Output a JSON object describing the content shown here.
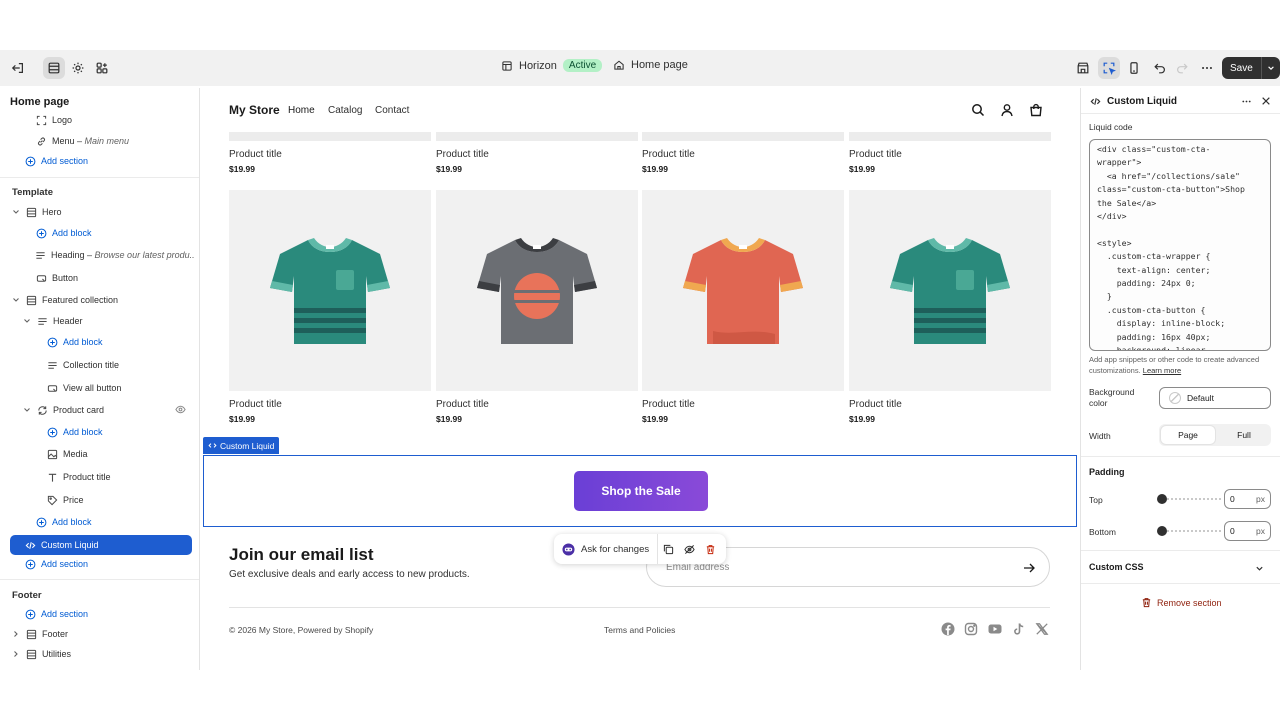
{
  "topbar": {
    "theme_name": "Horizon",
    "theme_status": "Active",
    "page_name": "Home page",
    "save_label": "Save"
  },
  "sidebar": {
    "title": "Home page",
    "header_items": {
      "logo": "Logo",
      "menu": "Menu",
      "menu_sub": "Main menu",
      "add_section": "Add section"
    },
    "template_label": "Template",
    "template": {
      "hero": "Hero",
      "add_block": "Add block",
      "heading": "Heading",
      "heading_sub": "Browse our latest produ...",
      "button": "Button",
      "featured_collection": "Featured collection",
      "header": "Header",
      "collection_title": "Collection title",
      "view_all_button": "View all button",
      "product_card": "Product card",
      "media": "Media",
      "product_title": "Product title",
      "price": "Price",
      "custom_liquid": "Custom Liquid",
      "add_section": "Add section"
    },
    "footer_label": "Footer",
    "footer": {
      "add_section": "Add section",
      "footer": "Footer",
      "utilities": "Utilities"
    }
  },
  "store": {
    "logo": "My Store",
    "nav": [
      "Home",
      "Catalog",
      "Contact"
    ],
    "products_row1": [
      {
        "title": "Product title",
        "price": "$19.99"
      },
      {
        "title": "Product title",
        "price": "$19.99"
      },
      {
        "title": "Product title",
        "price": "$19.99"
      },
      {
        "title": "Product title",
        "price": "$19.99"
      }
    ],
    "products_row2": [
      {
        "title": "Product title",
        "price": "$19.99",
        "shirt": "teal-striped"
      },
      {
        "title": "Product title",
        "price": "$19.99",
        "shirt": "gray-sunset"
      },
      {
        "title": "Product title",
        "price": "$19.99",
        "shirt": "red-plain"
      },
      {
        "title": "Product title",
        "price": "$19.99",
        "shirt": "teal-striped"
      }
    ],
    "custom_liquid_tag": "Custom Liquid",
    "sale_button": "Shop the Sale",
    "ask_label": "Ask for changes",
    "email_heading": "Join our email list",
    "email_sub": "Get exclusive deals and early access to new products.",
    "email_placeholder": "Email address",
    "copyright": "© 2026 My Store, Powered by Shopify",
    "terms": "Terms and Policies",
    "social_icons": [
      "facebook-icon",
      "instagram-icon",
      "youtube-icon",
      "tiktok-icon",
      "x-icon"
    ]
  },
  "panel": {
    "title": "Custom Liquid",
    "liquid_code_label": "Liquid code",
    "code": "<div class=\"custom-cta-\nwrapper\">\n  <a href=\"/collections/sale\"\nclass=\"custom-cta-button\">Shop\nthe Sale</a>\n</div>\n\n<style>\n  .custom-cta-wrapper {\n    text-align: center;\n    padding: 24px 0;\n  }\n  .custom-cta-button {\n    display: inline-block;\n    padding: 16px 40px;\n    background: linear-",
    "help_text": "Add app snippets or other code to create advanced customizations.",
    "learn_more": "Learn more",
    "bg_label": "Background color",
    "bg_value": "Default",
    "width_label": "Width",
    "width_options": [
      "Page",
      "Full"
    ],
    "padding_label": "Padding",
    "top_label": "Top",
    "top_value": "0",
    "bottom_label": "Bottom",
    "bottom_value": "0",
    "unit": "px",
    "custom_css_label": "Custom CSS",
    "remove_label": "Remove section"
  },
  "colors": {
    "accent": "#1e5dd0",
    "sale_gradient_start": "#6a3fd6",
    "sale_gradient_end": "#8a4ad8",
    "active_badge": "#b3f0c6"
  }
}
